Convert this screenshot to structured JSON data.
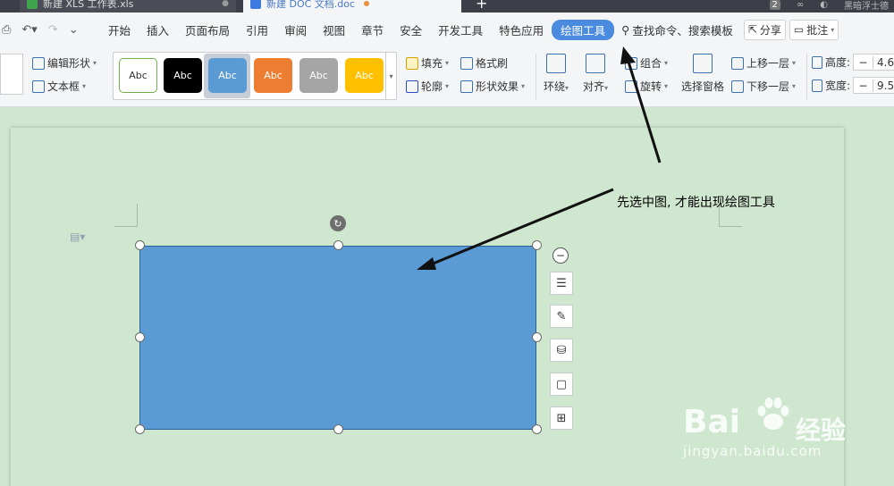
{
  "tabs": [
    {
      "name": "新建 XLS 工作表.xls"
    },
    {
      "name": "新建 DOC 文档.doc"
    }
  ],
  "titlebar": {
    "badge": "2",
    "user": "黑暗浮士德"
  },
  "menu": {
    "items": [
      "开始",
      "插入",
      "页面布局",
      "引用",
      "审阅",
      "视图",
      "章节",
      "安全",
      "开发工具",
      "特色应用"
    ],
    "active": "绘图工具",
    "search": "查找命令、搜索模板",
    "share": "分享",
    "comment": "批注"
  },
  "ribbon": {
    "edit_shape": "编辑形状",
    "text_box": "文本框",
    "style_labels": [
      "Abc",
      "Abc",
      "Abc",
      "Abc",
      "Abc",
      "Abc"
    ],
    "fill": "填充",
    "outline": "轮廓",
    "format_painter": "格式刷",
    "shape_effects": "形状效果",
    "wrap": "环绕",
    "align": "对齐",
    "group": "组合",
    "rotate": "旋转",
    "selection_pane": "选择窗格",
    "bring_forward": "上移一层",
    "send_backward": "下移一层",
    "height_label": "高度:",
    "height_value": "4.6",
    "width_label": "宽度:",
    "width_value": "9.5"
  },
  "colors": {
    "accent": "#4a8be0",
    "shape_fill": "#5b9bd5",
    "page_bg": "#cfe6cf",
    "swatches": [
      "#ffffff",
      "#000000",
      "#5b9bd5",
      "#ed7d31",
      "#a5a5a5",
      "#ffc000"
    ]
  },
  "annotation": "先选中图, 才能出现绘图工具",
  "watermark": {
    "brand": "Bai",
    "brand_cn": "经验",
    "url": "jingyan.baidu.com"
  }
}
